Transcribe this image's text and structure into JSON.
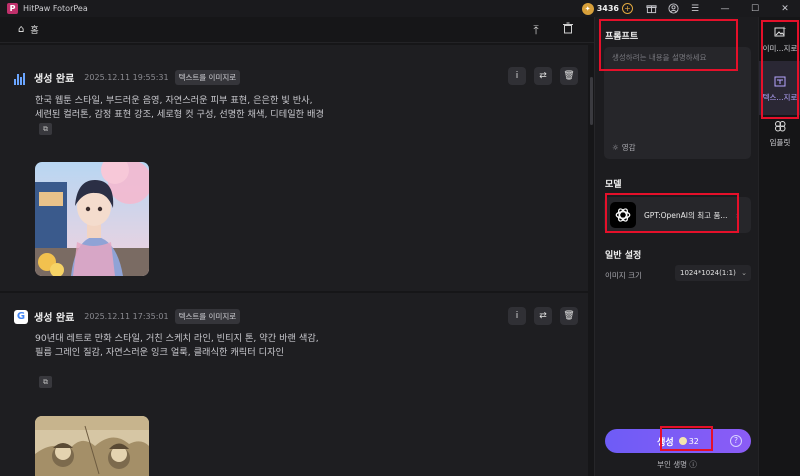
{
  "titlebar": {
    "app_name": "HitPaw FotorPea",
    "credits": "3436",
    "icons": [
      "app-logo",
      "gift-icon",
      "user-icon",
      "menu-icon",
      "minimize-icon",
      "maximize-icon",
      "close-icon"
    ]
  },
  "header": {
    "home_label": "홈"
  },
  "cards": [
    {
      "provider": "bars-provider-icon",
      "status": "생성 완료",
      "timestamp": "2025.12.11  19:55:31",
      "tag": "텍스트를 이미지로",
      "prompt_line1": "한국 웹툰 스타일, 부드러운 음영, 자연스러운 피부 표현, 은은한 빛 반사,",
      "prompt_line2": "세련된 컬러톤, 감정 표현 강조, 세로형 컷 구성, 선명한 채색, 디테일한 배경"
    },
    {
      "provider": "google-icon",
      "status": "생성 완료",
      "timestamp": "2025.12.11  17:35:01",
      "tag": "텍스트를 이미지로",
      "prompt_line1": "90년대 레트로 만화 스타일, 거친 스케치 라인, 빈티지 톤, 약간 바랜 색감,",
      "prompt_line2": "필름 그레인 질감, 자연스러운 잉크 얼룩, 클래식한 캐릭터 디자인"
    }
  ],
  "panel": {
    "prompt_title": "프롬프트",
    "prompt_placeholder": "생성하려는 내용을 설명하세요",
    "inspire_label": "영감",
    "model_title": "모델",
    "model_name": "GPT:OpenAI의 최고 품...",
    "general_title": "일반 설정",
    "size_label": "이미지 크기",
    "size_value": "1024*1024(1:1)",
    "generate_label": "생성",
    "generate_cost": "32",
    "partial_label": "부인 생명 ⓘ"
  },
  "rail": [
    {
      "label": "이미...지로",
      "icon": "image-plus-icon"
    },
    {
      "label": "텍스...지로",
      "icon": "text-to-image-icon"
    },
    {
      "label": "임플릿",
      "icon": "template-icon"
    }
  ],
  "colors": {
    "accent": "#7c5cf6",
    "highlight": "#e5102a",
    "coin": "#d8a03a"
  }
}
